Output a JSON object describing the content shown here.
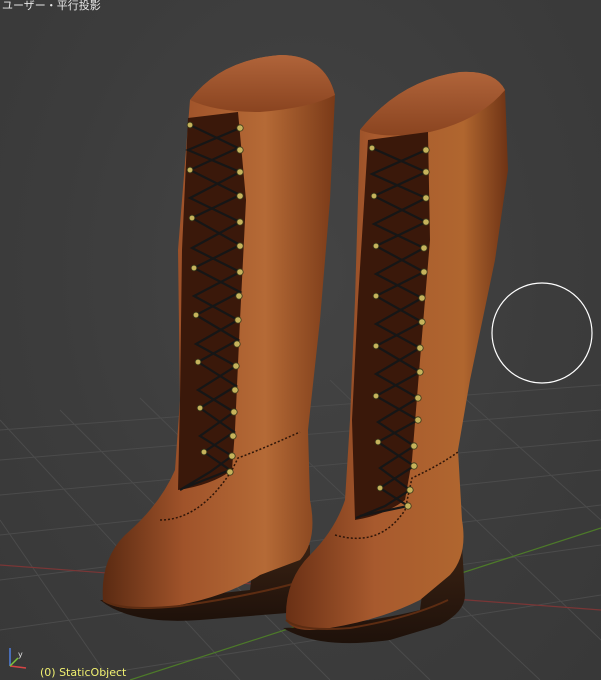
{
  "viewport": {
    "view_label": "ユーザー・平行投影",
    "object_label": "(0) StaticObject"
  },
  "gizmo": {
    "y_label": "y",
    "x_color": "#d64545",
    "y_color": "#7cc23b",
    "z_color": "#4f7fe0"
  },
  "colors": {
    "background": "#3d3d3d",
    "grid": "#4a4a4a",
    "x_axis": "#8a3d3d",
    "y_axis": "#4f7a2a",
    "leather": "#a5552a",
    "leather_dark": "#4a1f0d",
    "lace": "#1a1a1a",
    "eyelet": "#c9b864",
    "sole": "#2a170e",
    "cursor": "#ffffff"
  }
}
